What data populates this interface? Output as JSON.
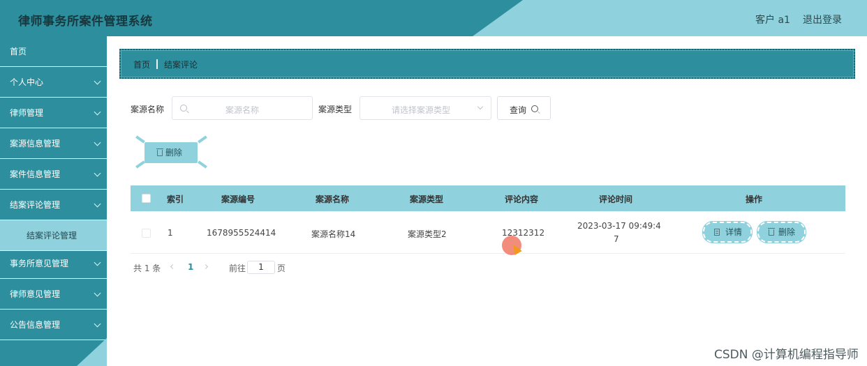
{
  "header": {
    "title": "律师事务所案件管理系统",
    "user": "客户 a1",
    "logout": "退出登录"
  },
  "sidebar": {
    "items": [
      {
        "label": "首页"
      },
      {
        "label": "个人中心"
      },
      {
        "label": "律师管理"
      },
      {
        "label": "案源信息管理"
      },
      {
        "label": "案件信息管理"
      },
      {
        "label": "结案评论管理"
      },
      {
        "label": "结案评论管理"
      },
      {
        "label": "事务所意见管理"
      },
      {
        "label": "律师意见管理"
      },
      {
        "label": "公告信息管理"
      }
    ]
  },
  "breadcrumb": {
    "home": "首页",
    "current": "结案评论"
  },
  "search": {
    "name_label": "案源名称",
    "name_placeholder": "案源名称",
    "type_label": "案源类型",
    "type_placeholder": "请选择案源类型",
    "query_button": "查询"
  },
  "toolbar": {
    "delete_label": "删除"
  },
  "table": {
    "columns": [
      "索引",
      "案源编号",
      "案源名称",
      "案源类型",
      "评论内容",
      "评论时间",
      "操作"
    ],
    "rows": [
      {
        "index": "1",
        "code": "1678955524414",
        "name": "案源名称14",
        "type": "案源类型2",
        "content": "12312312",
        "time_line1": "2023-03-17 09:49:4",
        "time_line2": "7",
        "detail": "详情",
        "delete": "删除"
      }
    ]
  },
  "pagination": {
    "total": "共 1 条",
    "current_page": "1",
    "goto_label": "前往",
    "goto_value": "1",
    "page_suffix": "页"
  },
  "watermark": "CSDN @计算机编程指导师",
  "colors": {
    "primary": "#2d8e9d",
    "light": "#8fd1dd"
  }
}
